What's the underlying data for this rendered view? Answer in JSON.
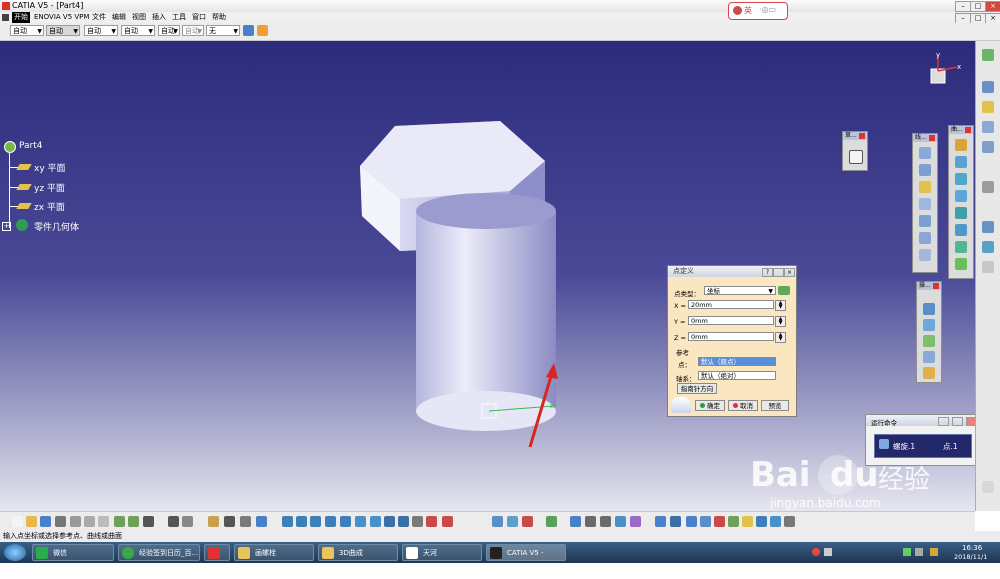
{
  "window": {
    "title": "CATIA V5 - [Part4]"
  },
  "menubar": {
    "items": [
      "开始",
      "ENOVIA V5 VPM",
      "文件",
      "编辑",
      "视图",
      "插入",
      "工具",
      "窗口",
      "帮助"
    ]
  },
  "toolbar1": {
    "combos": [
      "自动",
      "自动",
      "自动",
      "自动",
      "自动",
      "无"
    ]
  },
  "ime": {
    "label": "英"
  },
  "tree": {
    "root": "Part4",
    "items": [
      "xy 平面",
      "yz 平面",
      "zx 平面",
      "零件几何体"
    ]
  },
  "compass": {
    "x": "x",
    "y": "y"
  },
  "float_toolbars": {
    "sketch": {
      "title": "草..."
    },
    "wireframe": {
      "title": "线..."
    },
    "surface": {
      "title": "曲..."
    },
    "ops": {
      "title": "操..."
    }
  },
  "dialog": {
    "title": "点定义",
    "type_label": "点类型：",
    "type_value": "坐标",
    "x_label": "X =",
    "x_value": "20mm",
    "y_label": "Y =",
    "y_value": "0mm",
    "z_label": "Z =",
    "z_value": "0mm",
    "ref_section": "参考",
    "point_label": "点：",
    "point_value": "默认（原点）",
    "axis_label": "轴系：",
    "axis_value": "默认（绝对）",
    "compass_btn": "指南针方向",
    "ok": "确定",
    "cancel": "取消",
    "preview": "预览"
  },
  "run_command": {
    "title": "运行命令",
    "item1": "螺旋.1",
    "item2": "点.1"
  },
  "statusbar": {
    "text": "输入点坐标或选择参考点、曲线或曲面"
  },
  "taskbar": {
    "items": [
      "微信",
      "经验签到日历_百...",
      "",
      "画螺栓",
      "3D曲成",
      "天河PCCAD2010...",
      "CATIA V5 - [Part..."
    ],
    "time": "16:36",
    "date": "2018/11/1"
  },
  "watermark": {
    "brand": "Bai",
    "brand2": "du",
    "cn": "经验",
    "url": "jingyan.baidu.com"
  },
  "colors": {
    "viewport_top": "#2d2a7c",
    "dialog_bg": "#fbe6c2",
    "arrow": "#d9261c"
  }
}
